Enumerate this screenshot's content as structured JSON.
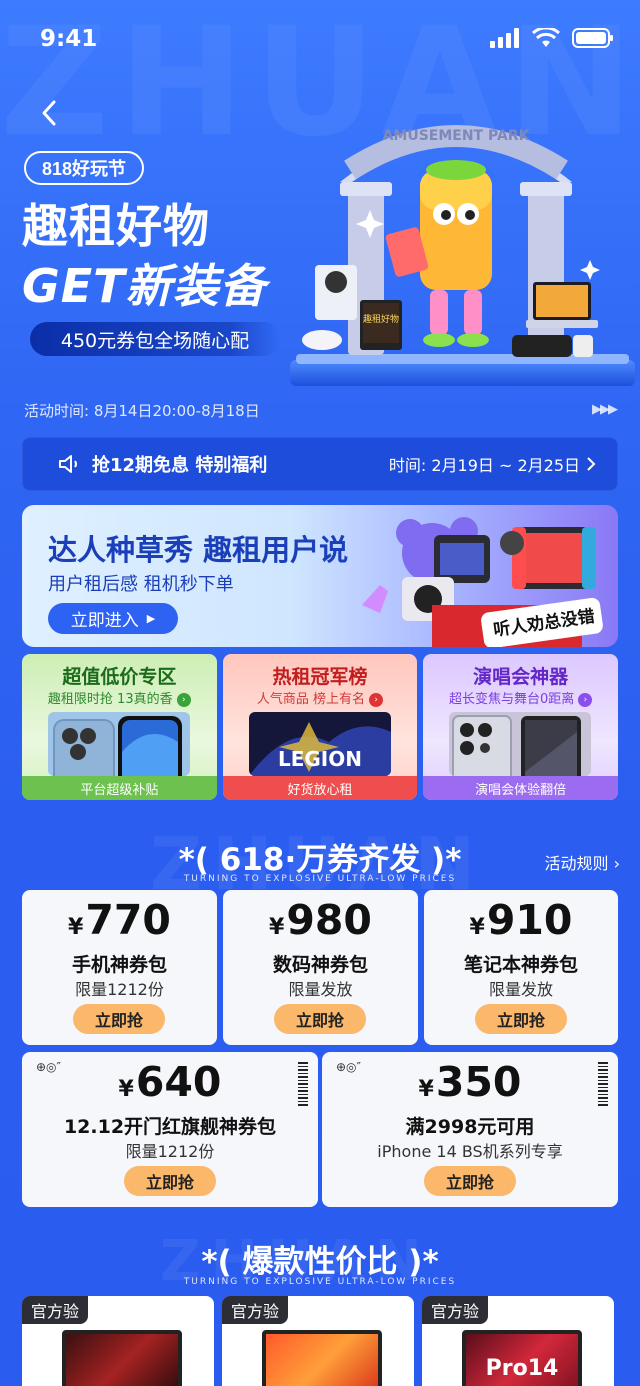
{
  "status": {
    "time": "9:41"
  },
  "hero": {
    "badge": "818好玩节",
    "title_line1": "趣租好物",
    "title_line2": "GET新装备",
    "subtitle": "450元券包全场随心配",
    "arch_text": "AMUSEMENT PARK",
    "sign_text": "趣租好物"
  },
  "activity_time": "活动时间: 8月14日20:00-8月18日",
  "notice": {
    "text": "抢12期免息 特别福利",
    "time": "时间: 2月19日 ~ 2月25日"
  },
  "banner": {
    "title": "达人种草秀 趣租用户说",
    "subtitle": "用户租后感   租机秒下单",
    "button": "立即进入",
    "bubble": "听人劝总没错"
  },
  "cards3": [
    {
      "title": "超值低价专区",
      "sub": "趣租限时抢 13真的香",
      "footer": "平台超级补贴",
      "color": "#71c95a",
      "bg": "#d7f2c4",
      "title_color": "#1b6b1b"
    },
    {
      "title": "热租冠军榜",
      "sub": "人气商品 榜上有名",
      "footer": "好货放心租",
      "color": "#f35a5a",
      "bg": "#ffd3cc",
      "title_color": "#c21d1d",
      "img_text": "LEGION"
    },
    {
      "title": "演唱会神器",
      "sub": "超长变焦与舞台0距离",
      "footer": "演唱会体验翻倍",
      "color": "#a26cf0",
      "bg": "#e3d2ff",
      "title_color": "#6327c9"
    }
  ],
  "section1": {
    "title": "*( 618·万券齐发 )*",
    "sub": "TURNING TO EXPLOSIVE ULTRA-LOW PRICES",
    "rules": "活动规则"
  },
  "coupons_row1": [
    {
      "amount": "770",
      "name": "手机神券包",
      "limit": "限量1212份",
      "button": "立即抢"
    },
    {
      "amount": "980",
      "name": "数码神券包",
      "limit": "限量发放",
      "button": "立即抢"
    },
    {
      "amount": "910",
      "name": "笔记本神券包",
      "limit": "限量发放",
      "button": "立即抢"
    }
  ],
  "coupons_row2": [
    {
      "amount": "640",
      "name": "12.12开门红旗舰神券包",
      "limit": "限量1212份",
      "button": "立即抢"
    },
    {
      "amount": "350",
      "name": "满2998元可用",
      "limit": "iPhone 14 BS机系列专享",
      "button": "立即抢"
    }
  ],
  "currency": "¥",
  "section2": {
    "title": "*( 爆款性价比 )*",
    "sub": "TURNING TO EXPLOSIVE ULTRA-LOW PRICES"
  },
  "products": [
    {
      "tag": "官方验"
    },
    {
      "tag": "官方验"
    },
    {
      "tag": "官方验",
      "screen_text": "Pro14"
    }
  ],
  "watermark": "ZHUAN"
}
